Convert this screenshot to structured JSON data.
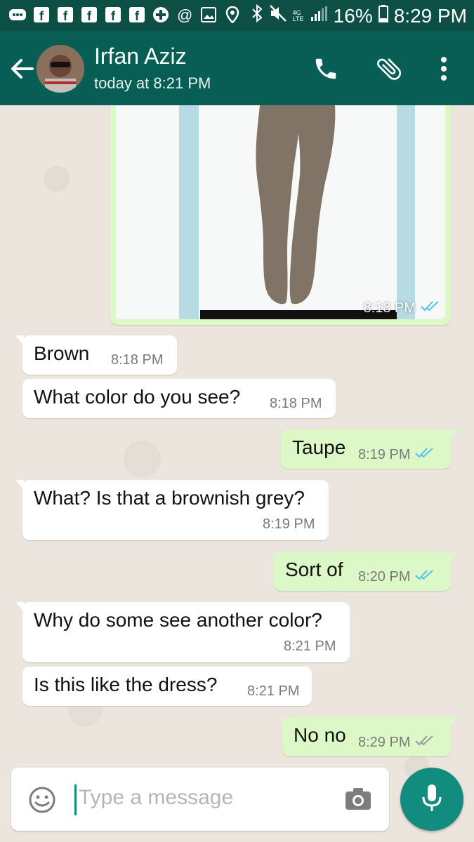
{
  "status_bar": {
    "battery": "16%",
    "time": "8:29 PM",
    "network": "4G LTE"
  },
  "header": {
    "contact_name": "Irfan Aziz",
    "last_seen": "today at 8:21 PM"
  },
  "messages": [
    {
      "direction": "out",
      "type": "image",
      "time": "8:18 PM",
      "status": "read"
    },
    {
      "direction": "in",
      "text": "Brown",
      "time": "8:18 PM"
    },
    {
      "direction": "in",
      "text": "What color do you see?",
      "time": "8:18 PM"
    },
    {
      "direction": "out",
      "text": "Taupe",
      "time": "8:19 PM",
      "status": "read"
    },
    {
      "direction": "in",
      "text": "What? Is that a brownish grey?",
      "time": "8:19 PM"
    },
    {
      "direction": "out",
      "text": "Sort of",
      "time": "8:20 PM",
      "status": "read"
    },
    {
      "direction": "in",
      "text": "Why do some see another color?",
      "time": "8:21 PM"
    },
    {
      "direction": "in",
      "text": "Is this like the dress?",
      "time": "8:21 PM"
    },
    {
      "direction": "out",
      "text": "No no",
      "time": "8:29 PM",
      "status": "delivered"
    }
  ],
  "input": {
    "placeholder": "Type a message"
  },
  "icons": {
    "back": "back-arrow-icon",
    "call": "phone-icon",
    "attach": "paperclip-icon",
    "menu": "more-vert-icon",
    "emoji": "emoji-icon",
    "camera": "camera-icon",
    "mic": "mic-icon"
  },
  "colors": {
    "status_bar": "#0b4f45",
    "app_bar": "#075e54",
    "outgoing_bubble": "#dcf8c6",
    "incoming_bubble": "#ffffff",
    "accent": "#128c7e",
    "read_ticks": "#4fc3f7"
  }
}
